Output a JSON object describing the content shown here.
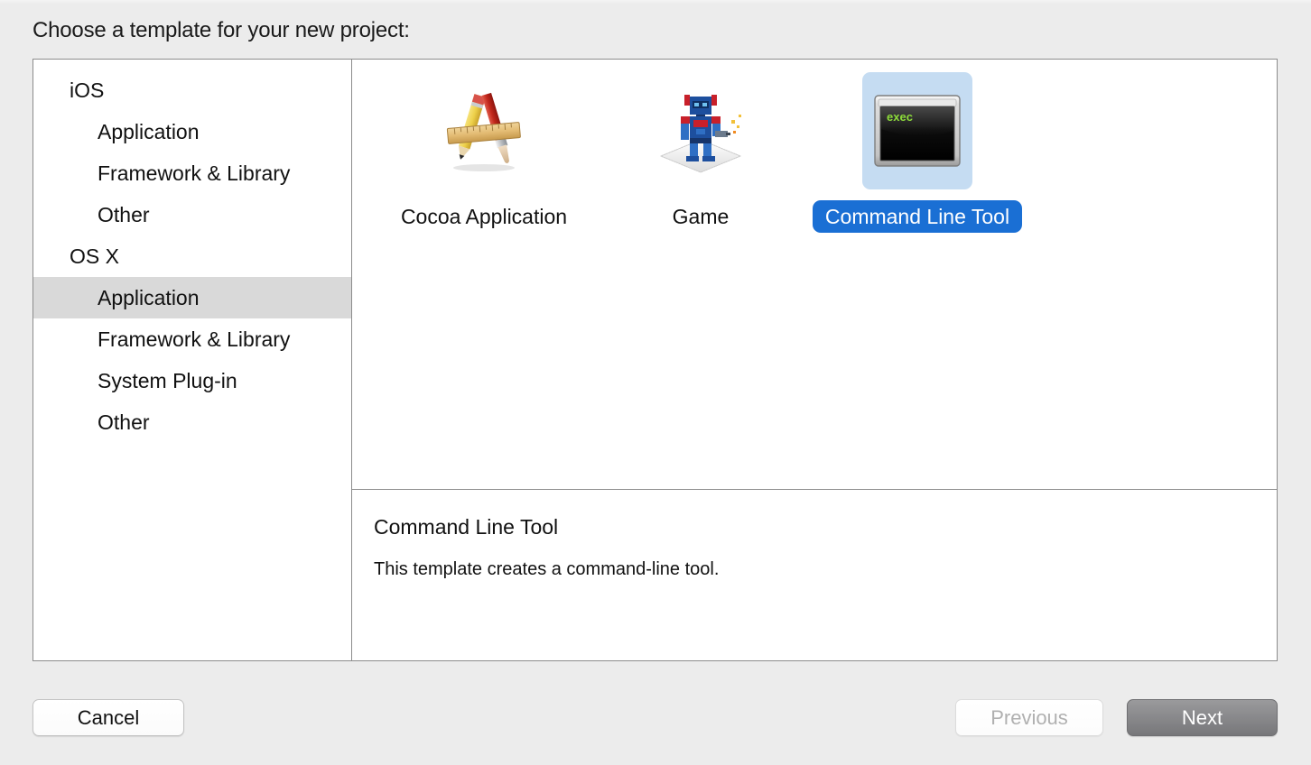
{
  "dialog": {
    "title": "Choose a template for your new project:"
  },
  "sidebar": {
    "items": [
      {
        "label": "iOS",
        "type": "group",
        "selected": false
      },
      {
        "label": "Application",
        "type": "child",
        "selected": false
      },
      {
        "label": "Framework & Library",
        "type": "child",
        "selected": false
      },
      {
        "label": "Other",
        "type": "child",
        "selected": false
      },
      {
        "label": "OS X",
        "type": "group",
        "selected": false
      },
      {
        "label": "Application",
        "type": "child",
        "selected": true
      },
      {
        "label": "Framework & Library",
        "type": "child",
        "selected": false
      },
      {
        "label": "System Plug-in",
        "type": "child",
        "selected": false
      },
      {
        "label": "Other",
        "type": "child",
        "selected": false
      }
    ]
  },
  "templates": [
    {
      "label": "Cocoa Application",
      "icon": "cocoa-application-icon",
      "selected": false
    },
    {
      "label": "Game",
      "icon": "game-robot-icon",
      "selected": false
    },
    {
      "label": "Command Line Tool",
      "icon": "terminal-exec-icon",
      "selected": true
    }
  ],
  "description": {
    "title": "Command Line Tool",
    "body": "This template creates a command-line tool."
  },
  "terminal_icon": {
    "screen_text": "exec"
  },
  "footer": {
    "cancel_label": "Cancel",
    "previous_label": "Previous",
    "next_label": "Next"
  },
  "colors": {
    "window_background": "#ececec",
    "panel_background": "#ffffff",
    "panel_border": "#8c8c8c",
    "sidebar_selection": "#d9d9d9",
    "tile_selection_blue": "#1a6fd4",
    "tile_icon_selection": "#c5dcf2",
    "terminal_text_green": "#8ddc3a",
    "next_button_gray": "#88888b"
  }
}
